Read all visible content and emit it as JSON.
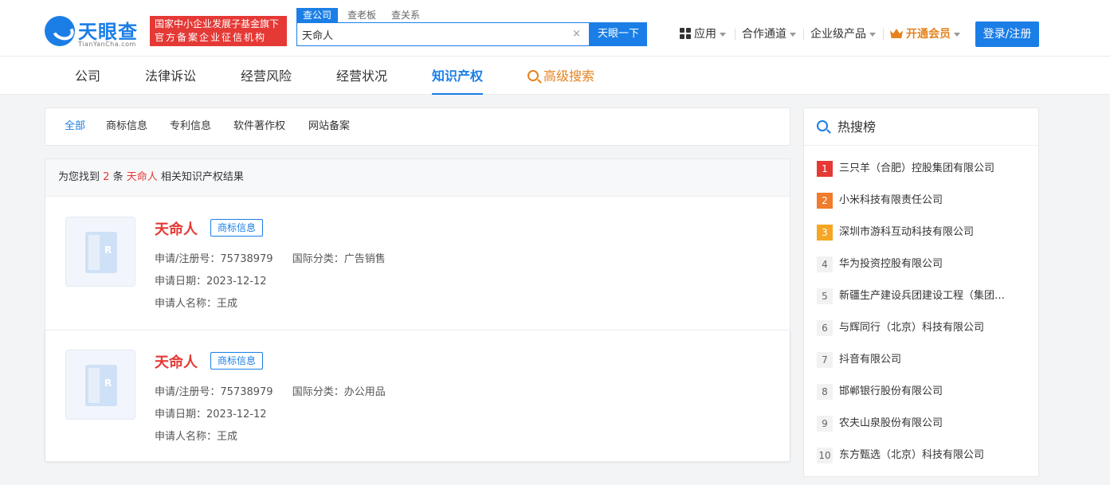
{
  "brand": {
    "name": "天眼查",
    "domain": "TianYanCha.com",
    "badge_line1": "国家中小企业发展子基金旗下",
    "badge_line2": "官方备案企业征信机构"
  },
  "search": {
    "tabs": [
      "查公司",
      "查老板",
      "查关系"
    ],
    "active_tab": "查公司",
    "value": "天命人",
    "clear": "×",
    "button": "天眼一下"
  },
  "topnav": {
    "apps": "应用",
    "cooperation": "合作通道",
    "enterprise": "企业级产品",
    "vip": "开通会员",
    "login": "登录/注册"
  },
  "mainnav": {
    "items": [
      "公司",
      "法律诉讼",
      "经营风险",
      "经营状况",
      "知识产权"
    ],
    "active": "知识产权",
    "advanced": "高级搜索"
  },
  "filters": {
    "items": [
      "全部",
      "商标信息",
      "专利信息",
      "软件著作权",
      "网站备案"
    ],
    "active": "全部"
  },
  "results": {
    "prefix": "为您找到",
    "count": "2",
    "unit": "条",
    "keyword": "天命人",
    "suffix": "相关知识产权结果",
    "items": [
      {
        "name": "天命人",
        "tag": "商标信息",
        "reg_label": "申请/注册号：",
        "reg_no": "75738979",
        "class_label": "国际分类：",
        "class": "广告销售",
        "date_label": "申请日期：",
        "date": "2023-12-12",
        "applicant_label": "申请人名称：",
        "applicant": "王成"
      },
      {
        "name": "天命人",
        "tag": "商标信息",
        "reg_label": "申请/注册号：",
        "reg_no": "75738979",
        "class_label": "国际分类：",
        "class": "办公用品",
        "date_label": "申请日期：",
        "date": "2023-12-12",
        "applicant_label": "申请人名称：",
        "applicant": "王成"
      }
    ]
  },
  "hot": {
    "title": "热搜榜",
    "items": [
      {
        "rank": "1",
        "name": "三只羊（合肥）控股集团有限公司"
      },
      {
        "rank": "2",
        "name": "小米科技有限责任公司"
      },
      {
        "rank": "3",
        "name": "深圳市游科互动科技有限公司"
      },
      {
        "rank": "4",
        "name": "华为投资控股有限公司"
      },
      {
        "rank": "5",
        "name": "新疆生产建设兵团建设工程（集团…"
      },
      {
        "rank": "6",
        "name": "与辉同行（北京）科技有限公司"
      },
      {
        "rank": "7",
        "name": "抖音有限公司"
      },
      {
        "rank": "8",
        "name": "邯郸银行股份有限公司"
      },
      {
        "rank": "9",
        "name": "农夫山泉股份有限公司"
      },
      {
        "rank": "10",
        "name": "东方甄选（北京）科技有限公司"
      }
    ]
  },
  "colors": {
    "primary": "#1b7ee6",
    "accent_red": "#e53935",
    "vip_orange": "#e6821e"
  }
}
